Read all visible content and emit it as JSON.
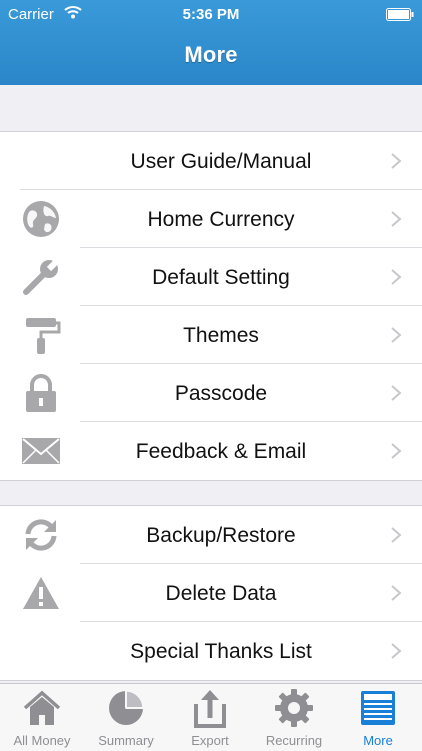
{
  "status": {
    "carrier": "Carrier",
    "time": "5:36 PM"
  },
  "header": {
    "title": "More"
  },
  "groups": [
    {
      "items": [
        {
          "label": "User Guide/Manual",
          "icon": "none"
        },
        {
          "label": "Home Currency",
          "icon": "globe-icon"
        },
        {
          "label": "Default Setting",
          "icon": "wrench-icon"
        },
        {
          "label": "Themes",
          "icon": "paint-roller-icon"
        },
        {
          "label": "Passcode",
          "icon": "lock-icon"
        },
        {
          "label": "Feedback & Email",
          "icon": "envelope-icon"
        }
      ]
    },
    {
      "items": [
        {
          "label": "Backup/Restore",
          "icon": "sync-icon"
        },
        {
          "label": "Delete Data",
          "icon": "warning-icon"
        },
        {
          "label": "Special Thanks List",
          "icon": "none"
        }
      ]
    }
  ],
  "tabs": [
    {
      "label": "All Money",
      "icon": "house-icon"
    },
    {
      "label": "Summary",
      "icon": "pie-chart-icon"
    },
    {
      "label": "Export",
      "icon": "export-icon"
    },
    {
      "label": "Recurring",
      "icon": "gear-icon"
    },
    {
      "label": "More",
      "icon": "more-icon",
      "active": true
    }
  ],
  "colors": {
    "header": "#2a86c8",
    "active_tab": "#1a7fd6",
    "icon_gray": "#a8a8ab"
  }
}
